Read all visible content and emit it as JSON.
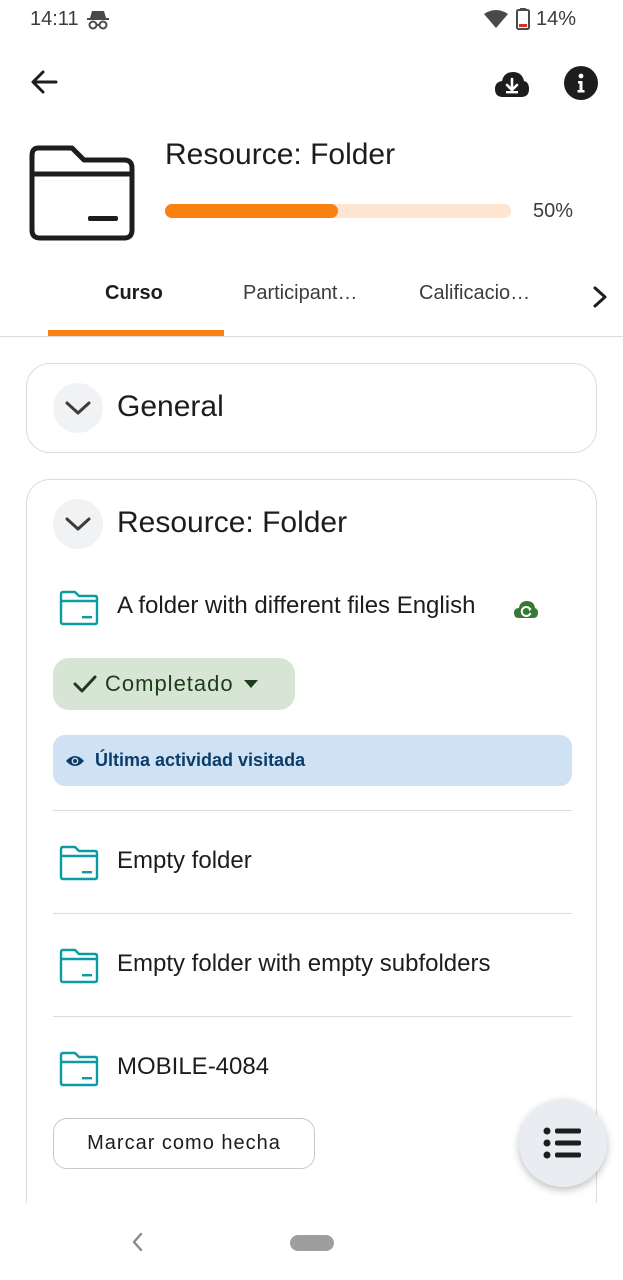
{
  "status_bar": {
    "time": "14:11",
    "battery": "14%",
    "icons": [
      "incognito-icon",
      "wifi-icon",
      "battery-low-icon"
    ]
  },
  "app_bar": {
    "icons": [
      "back-arrow-icon",
      "cloud-download-icon",
      "info-icon"
    ]
  },
  "header": {
    "title": "Resource: Folder",
    "progress_percent": 50,
    "progress_label": "50%"
  },
  "tabs": [
    {
      "label": "Curso",
      "active": true
    },
    {
      "label": "Participant…",
      "active": false
    },
    {
      "label": "Calificacio…",
      "active": false
    }
  ],
  "sections": {
    "general": {
      "title": "General"
    },
    "resource": {
      "title": "Resource: Folder",
      "modules": [
        {
          "name": "A folder with different files English"
        },
        {
          "name": "Empty folder"
        },
        {
          "name": "Empty folder with empty subfolders"
        },
        {
          "name": "MOBILE-4084"
        }
      ],
      "completed_label": "Completado",
      "visited_label": "Última actividad visitada",
      "mark_done_label": "Marcar como hecha"
    }
  },
  "colors": {
    "accent": "#f98012",
    "progress_track": "#fde5d2",
    "completed_bg": "#d7e5d5",
    "visited_bg": "#cfe2f3",
    "folder_icon": "#0a9ba3",
    "sync_icon": "#357a32"
  }
}
